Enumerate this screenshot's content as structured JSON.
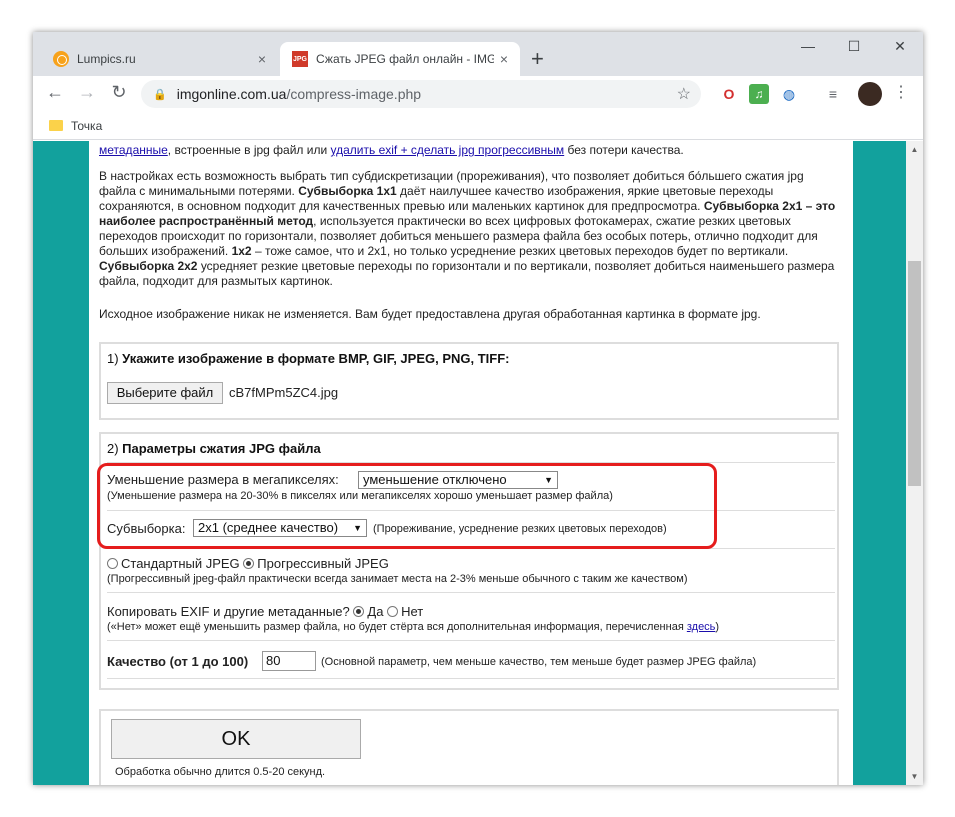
{
  "browser": {
    "tabs": [
      {
        "title": "Lumpics.ru",
        "close": "×"
      },
      {
        "title": "Сжать JPEG файл онлайн - IMG",
        "close": "×",
        "favicon_text": "JPG"
      }
    ],
    "new_tab": "+",
    "window_controls": {
      "minimize": "—",
      "maximize": "☐",
      "close": "✕"
    },
    "nav": {
      "back": "←",
      "forward": "→",
      "reload": "↻"
    },
    "url_host": "imgonline.com.ua",
    "url_path": "/compress-image.php",
    "bookmark_star": "☆",
    "extensions": {
      "opera": "O",
      "music": "♫",
      "globe": "◍",
      "list": "≡"
    },
    "menu": "⋮",
    "bookmarks": [
      {
        "label": "Точка"
      }
    ]
  },
  "page": {
    "intro_link1": "метаданные",
    "intro_text1": ", встроенные в jpg файл или ",
    "intro_link2": "удалить exif + сделать jpg прогрессивным",
    "intro_text2": " без потери качества.",
    "p2_a": "В настройках есть возможность выбрать тип субдискретизации (прореживания), что позволяет добиться бо́льшего сжатия jpg файла с минимальными потерями. ",
    "p2_b": "Субвыборка 1x1",
    "p2_c": " даёт наилучшее качество изображения, яркие цветовые переходы сохраняются, в основном подходит для качественных превью или маленьких картинок для предпросмотра. ",
    "p2_d": "Субвыборка 2x1 – это наиболее распространённый метод",
    "p2_e": ", используется практически во всех цифровых фотокамерах, сжатие резких цветовых переходов происходит по горизонтали, позволяет добиться меньшего размера файла без особых потерь, отлично подходит для больших изображений. ",
    "p2_f": "1x2",
    "p2_g": " – тоже самое, что и 2x1, но только усреднение резких цветовых переходов будет по вертикали. ",
    "p2_h": "Субвыборка 2x2",
    "p2_i": " усредняет резкие цветовые переходы по горизонтали и по вертикали, позволяет добиться наименьшего размера файла, подходит для размытых картинок.",
    "p3": "Исходное изображение никак не изменяется. Вам будет предоставлена другая обработанная картинка в формате jpg.",
    "step1": {
      "prefix": "1) ",
      "title": "Укажите изображение в формате BMP, GIF, JPEG, PNG, TIFF:",
      "file_button": "Выберите файл",
      "file_name": "cB7fMPm5ZC4.jpg"
    },
    "step2": {
      "prefix": "2) ",
      "title": "Параметры сжатия JPG файла",
      "megapixels_label": "Уменьшение размера в мегапикселях:",
      "megapixels_value": "уменьшение отключено",
      "megapixels_hint": "(Уменьшение размера на 20-30% в пикселях или мегапикселях хорошо уменьшает размер файла)",
      "subsampling_label": "Субвыборка:",
      "subsampling_value": "2x1 (среднее качество)",
      "subsampling_hint": "(Прореживание, усреднение резких цветовых переходов)",
      "standard_jpeg": "Стандартный JPEG",
      "progressive_jpeg": "Прогрессивный JPEG",
      "progressive_hint": "(Прогрессивный jpeg-файл практически всегда занимает места на 2-3% меньше обычного с таким же качеством)",
      "exif_label": "Копировать EXIF и другие метаданные?",
      "exif_yes": "Да",
      "exif_no": "Нет",
      "exif_hint_a": "(«Нет» может ещё уменьшить размер файла, но будет стёрта вся дополнительная информация, перечисленная ",
      "exif_hint_link": "здесь",
      "exif_hint_b": ")",
      "quality_label": "Качество (от 1 до 100)",
      "quality_value": "80",
      "quality_hint": "(Основной параметр, чем меньше качество, тем меньше будет размер JPEG файла)"
    },
    "ok_button": "OK",
    "processing_note": "Обработка обычно длится 0.5-20 секунд."
  },
  "scrollbar": {
    "up": "▲",
    "down": "▼"
  },
  "colors": {
    "page_bg": "#12a19d",
    "highlight": "#e51d1d",
    "link": "#1a0dab"
  }
}
